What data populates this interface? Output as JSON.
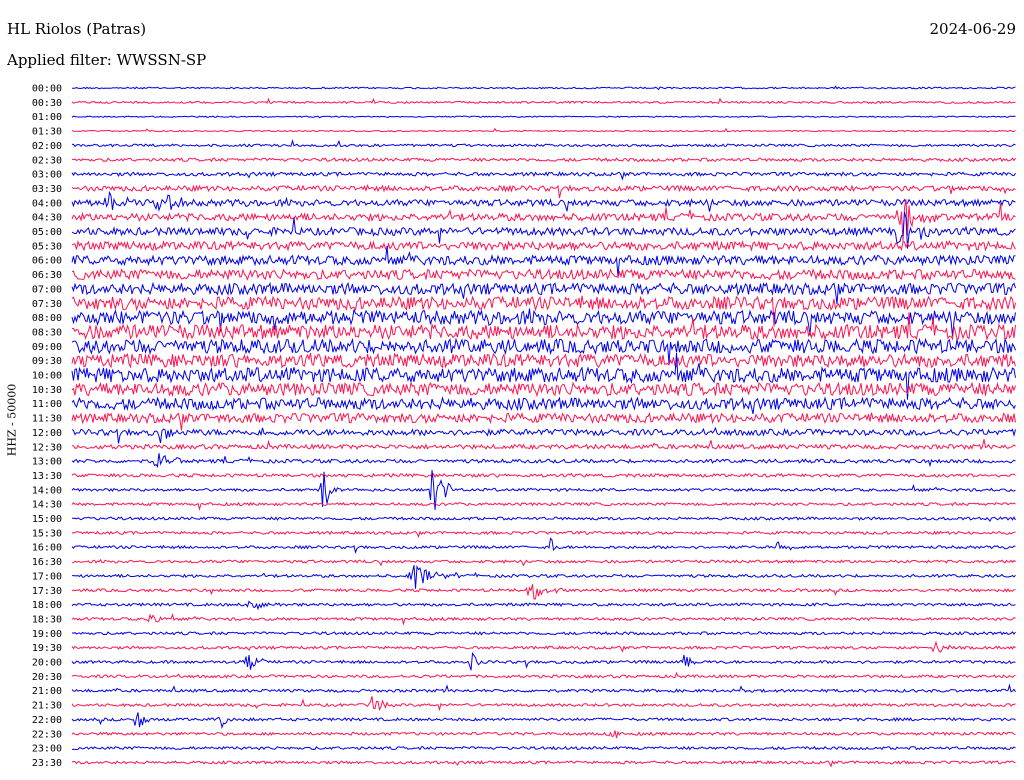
{
  "header": {
    "station": "HL Riolos (Patras)",
    "date": "2024-06-29",
    "filter_label": "Applied filter: WWSSN-SP"
  },
  "channel_label": "HHZ - 50000",
  "colors": {
    "odd_trace": "#0000ee",
    "even_trace": "#ff1450"
  },
  "chart_data": {
    "type": "line",
    "title": "HL Riolos (Patras)",
    "subtitle": "Applied filter: WWSSN-SP",
    "ylabel": "HHZ - 50000",
    "y_tick_labels": [
      "00:00",
      "00:30",
      "01:00",
      "01:30",
      "02:00",
      "02:30",
      "03:00",
      "03:30",
      "04:00",
      "04:30",
      "05:00",
      "05:30",
      "06:00",
      "06:30",
      "07:00",
      "07:30",
      "08:00",
      "08:30",
      "09:00",
      "09:30",
      "10:00",
      "10:30",
      "11:00",
      "11:30",
      "12:00",
      "12:30",
      "13:00",
      "13:30",
      "14:00",
      "14:30",
      "15:00",
      "15:30",
      "16:00",
      "16:30",
      "17:00",
      "17:30",
      "18:00",
      "18:30",
      "19:00",
      "19:30",
      "20:00",
      "20:30",
      "21:00",
      "21:30",
      "22:00",
      "22:30",
      "23:00",
      "23:30"
    ],
    "trace_noise_level": [
      0.8,
      1.0,
      0.6,
      0.6,
      1.2,
      1.6,
      1.8,
      2.6,
      3.2,
      3.6,
      3.8,
      4.2,
      4.6,
      5.0,
      5.6,
      6.4,
      6.8,
      7.2,
      7.0,
      6.6,
      7.2,
      6.4,
      5.8,
      4.6,
      3.0,
      2.2,
      1.8,
      1.6,
      1.4,
      1.4,
      1.4,
      1.4,
      1.4,
      1.4,
      1.4,
      1.4,
      1.4,
      1.4,
      1.4,
      1.4,
      1.4,
      1.4,
      1.4,
      1.4,
      1.4,
      1.4,
      1.4,
      1.4
    ],
    "events": [
      {
        "line": 8,
        "x_frac": 0.033,
        "amplitude": 18,
        "duration_frac": 0.03
      },
      {
        "line": 8,
        "x_frac": 0.088,
        "amplitude": 22,
        "duration_frac": 0.03
      },
      {
        "line": 9,
        "x_frac": 0.87,
        "amplitude": 26,
        "duration_frac": 0.05
      },
      {
        "line": 10,
        "x_frac": 0.87,
        "amplitude": 22,
        "duration_frac": 0.05
      },
      {
        "line": 24,
        "x_frac": 0.09,
        "amplitude": 14,
        "duration_frac": 0.02
      },
      {
        "line": 26,
        "x_frac": 0.085,
        "amplitude": 12,
        "duration_frac": 0.04
      },
      {
        "line": 28,
        "x_frac": 0.262,
        "amplitude": 28,
        "duration_frac": 0.02
      },
      {
        "line": 28,
        "x_frac": 0.376,
        "amplitude": 36,
        "duration_frac": 0.03
      },
      {
        "line": 32,
        "x_frac": 0.505,
        "amplitude": 14,
        "duration_frac": 0.01
      },
      {
        "line": 32,
        "x_frac": 0.745,
        "amplitude": 14,
        "duration_frac": 0.01
      },
      {
        "line": 34,
        "x_frac": 0.355,
        "amplitude": 12,
        "duration_frac": 0.06
      },
      {
        "line": 35,
        "x_frac": 0.48,
        "amplitude": 12,
        "duration_frac": 0.04
      },
      {
        "line": 36,
        "x_frac": 0.18,
        "amplitude": 10,
        "duration_frac": 0.04
      },
      {
        "line": 37,
        "x_frac": 0.08,
        "amplitude": 10,
        "duration_frac": 0.02
      },
      {
        "line": 39,
        "x_frac": 0.91,
        "amplitude": 12,
        "duration_frac": 0.02
      },
      {
        "line": 40,
        "x_frac": 0.18,
        "amplitude": 12,
        "duration_frac": 0.03
      },
      {
        "line": 40,
        "x_frac": 0.42,
        "amplitude": 12,
        "duration_frac": 0.02
      },
      {
        "line": 40,
        "x_frac": 0.645,
        "amplitude": 12,
        "duration_frac": 0.02
      },
      {
        "line": 43,
        "x_frac": 0.315,
        "amplitude": 16,
        "duration_frac": 0.02
      },
      {
        "line": 44,
        "x_frac": 0.065,
        "amplitude": 14,
        "duration_frac": 0.02
      },
      {
        "line": 44,
        "x_frac": 0.155,
        "amplitude": 12,
        "duration_frac": 0.02
      },
      {
        "line": 45,
        "x_frac": 0.565,
        "amplitude": 12,
        "duration_frac": 0.02
      }
    ]
  }
}
